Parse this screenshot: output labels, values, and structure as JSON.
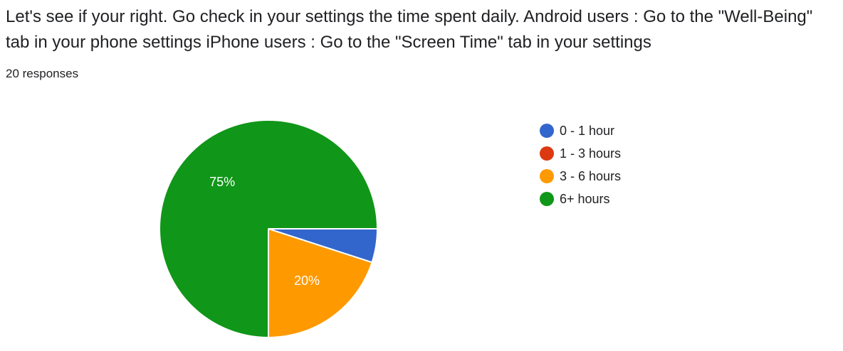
{
  "question": {
    "title": "Let's see if your right. Go check in your settings the time spent daily.  Android users : Go to the \"Well-Being\" tab in your phone settings iPhone users : Go to the \"Screen Time\" tab in your settings",
    "responses": "20 responses"
  },
  "chart_data": {
    "type": "pie",
    "categories": [
      "0 - 1 hour",
      "1 - 3 hours",
      "3 - 6 hours",
      "6+ hours"
    ],
    "values": [
      5,
      0,
      20,
      75
    ],
    "value_labels": [
      "",
      "",
      "20%",
      "75%"
    ],
    "colors": [
      "#3366cc",
      "#dc3912",
      "#ff9900",
      "#109618"
    ],
    "legend": "right",
    "title": ""
  }
}
